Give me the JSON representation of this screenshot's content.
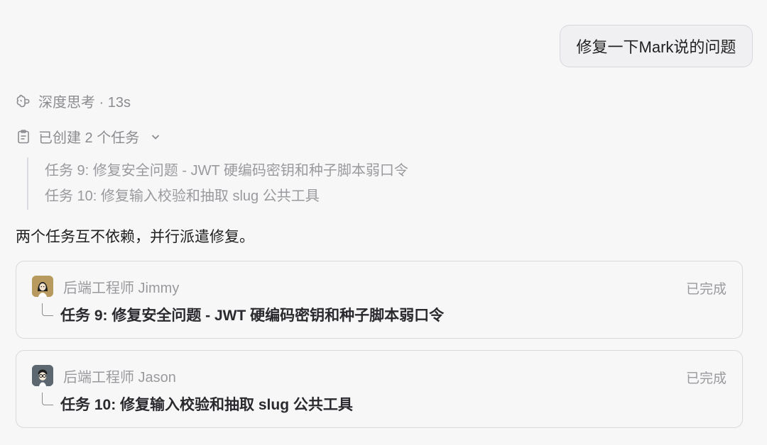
{
  "user_message": "修复一下Mark说的问题",
  "thinking": {
    "icon": "brain-icon",
    "label": "深度思考 · 13s"
  },
  "tasks_summary": {
    "icon": "clipboard-icon",
    "label": "已创建 2 个任务",
    "items": [
      "任务 9: 修复安全问题 - JWT 硬编码密钥和种子脚本弱口令",
      "任务 10: 修复输入校验和抽取 slug 公共工具"
    ]
  },
  "assistant_message": "两个任务互不依赖，并行派遣修复。",
  "agent_cards": [
    {
      "agent": "后端工程师 Jimmy",
      "status": "已完成",
      "task": "任务 9: 修复安全问题 - JWT 硬编码密钥和种子脚本弱口令"
    },
    {
      "agent": "后端工程师 Jason",
      "status": "已完成",
      "task": "任务 10: 修复输入校验和抽取 slug 公共工具"
    }
  ],
  "colors": {
    "background": "#f7f7f8",
    "muted_text": "#9a9a9e",
    "border": "#d9d9de"
  }
}
